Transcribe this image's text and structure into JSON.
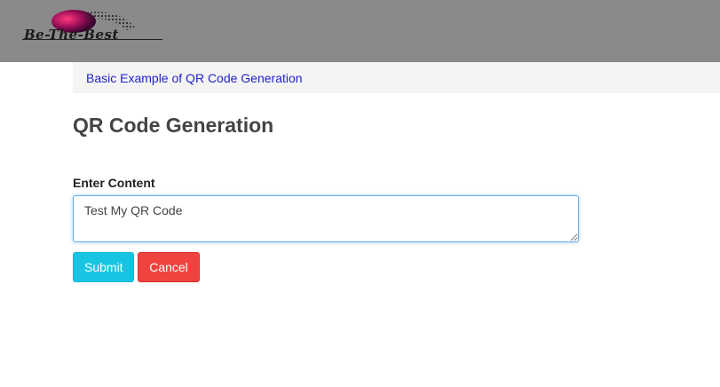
{
  "header": {
    "logo_text": "Be-The-Best"
  },
  "breadcrumb": {
    "link_text": "Basic Example of QR Code Generation"
  },
  "page": {
    "title": "QR Code Generation"
  },
  "form": {
    "content_label": "Enter Content",
    "content_value": "Test My QR Code",
    "submit_label": "Submit",
    "cancel_label": "Cancel"
  },
  "colors": {
    "header_bg": "#8a8a8a",
    "breadcrumb_bg": "#f4f4f4",
    "link": "#2222cc",
    "submit": "#17c5e3",
    "cancel": "#f0433f",
    "input_focus_border": "#66afe9"
  }
}
